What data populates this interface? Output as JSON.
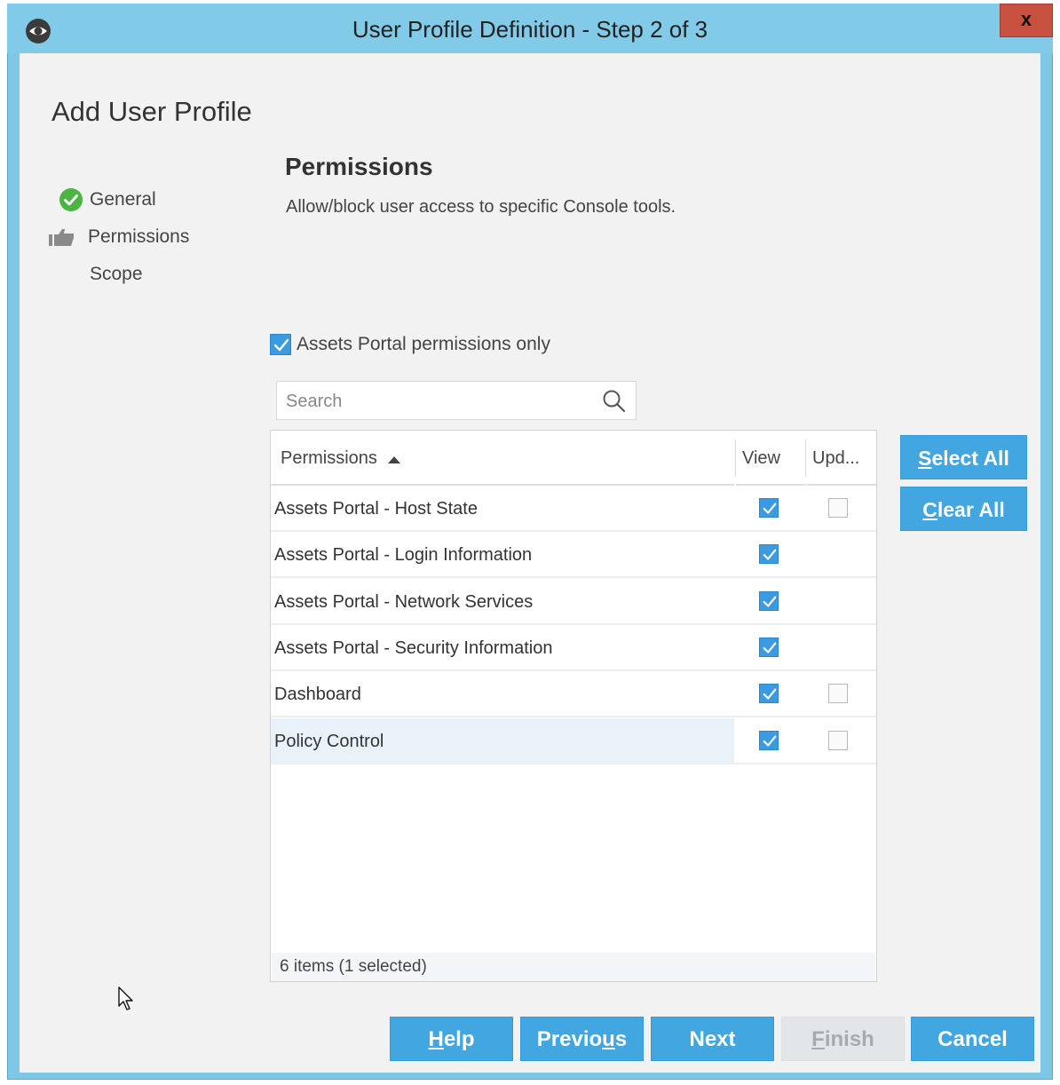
{
  "window": {
    "title": "User Profile Definition - Step 2 of 3",
    "close_label": "x"
  },
  "page_title": "Add User Profile",
  "steps": [
    {
      "label": "General",
      "state": "done",
      "icon": "check-circle-icon"
    },
    {
      "label": "Permissions",
      "state": "current",
      "icon": "thumbs-up-icon"
    },
    {
      "label": "Scope",
      "state": "pending",
      "icon": ""
    }
  ],
  "section": {
    "title": "Permissions",
    "description": "Allow/block user access to specific Console tools."
  },
  "assets_only": {
    "label": "Assets Portal permissions only",
    "checked": true
  },
  "search": {
    "placeholder": "Search",
    "value": ""
  },
  "table": {
    "columns": {
      "permissions": "Permissions",
      "view": "View",
      "update": "Upd..."
    },
    "sort": "ascending",
    "rows": [
      {
        "name": "Assets Portal - Host State",
        "view": true,
        "update": false,
        "has_update": true,
        "selected": false
      },
      {
        "name": "Assets Portal - Login Information",
        "view": true,
        "update": null,
        "has_update": false,
        "selected": false
      },
      {
        "name": "Assets Portal - Network Services",
        "view": true,
        "update": null,
        "has_update": false,
        "selected": false
      },
      {
        "name": "Assets Portal - Security Information",
        "view": true,
        "update": null,
        "has_update": false,
        "selected": false
      },
      {
        "name": "Dashboard",
        "view": true,
        "update": false,
        "has_update": true,
        "selected": false
      },
      {
        "name": "Policy Control",
        "view": true,
        "update": false,
        "has_update": true,
        "selected": true
      }
    ],
    "status": "6 items (1 selected)"
  },
  "side_buttons": {
    "select_all": {
      "mnemonic": "S",
      "rest": "elect All"
    },
    "clear_all": {
      "mnemonic": "C",
      "rest": "lear All"
    }
  },
  "footer_buttons": {
    "help": {
      "mnemonic": "H",
      "rest": "elp"
    },
    "previous": {
      "pre": "Previo",
      "mnemonic": "u",
      "rest": "s"
    },
    "next": {
      "label": "Next"
    },
    "finish": {
      "mnemonic": "F",
      "rest": "inish",
      "enabled": false
    },
    "cancel": {
      "label": "Cancel"
    }
  },
  "colors": {
    "titlebar": "#82cbe8",
    "accent": "#42a6e0",
    "close": "#c7503f",
    "check": "#3c9ae0"
  }
}
